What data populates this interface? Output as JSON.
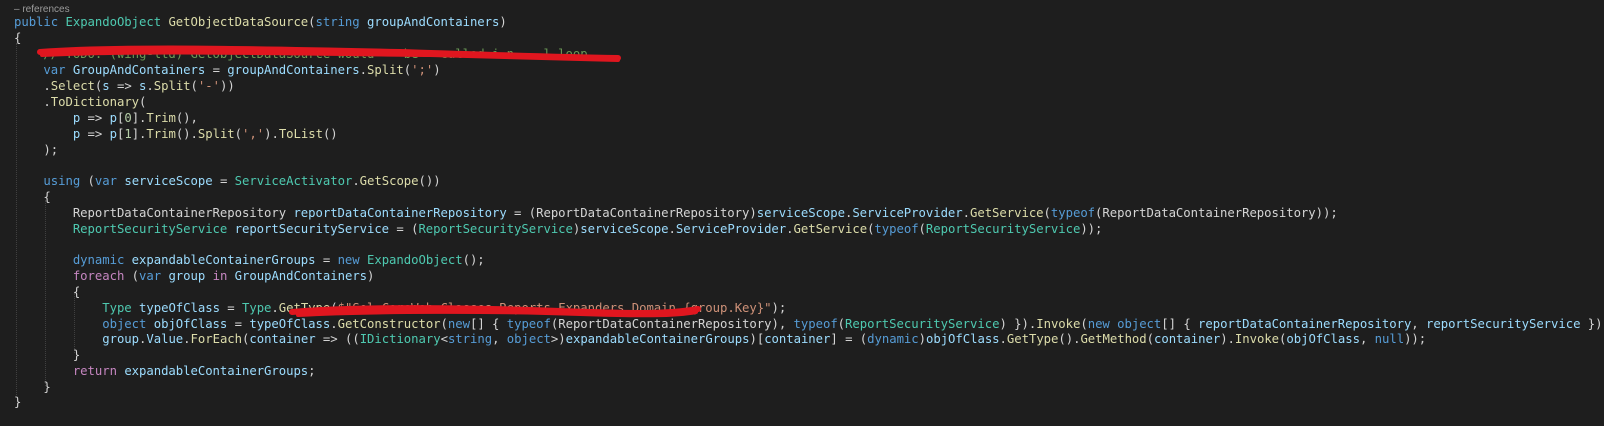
{
  "codelens": "– references",
  "lines": [
    "public ExpandoObject GetObjectDataSource(string groupAndContainers)",
    "{",
    "    // TODO: (wing-ltd) GetObjectDataSource would    be   called i n . .l loop",
    "    var GroupAndContainers = groupAndContainers.Split(';')",
    "    .Select(s => s.Split('-'))",
    "    .ToDictionary(",
    "        p => p[0].Trim(),",
    "        p => p[1].Trim().Split(',').ToList()",
    "    );",
    "",
    "    using (var serviceScope = ServiceActivator.GetScope())",
    "    {",
    "        ReportDataContainerRepository reportDataContainerRepository = (ReportDataContainerRepository)serviceScope.ServiceProvider.GetService(typeof(ReportDataContainerRepository));",
    "        ReportSecurityService reportSecurityService = (ReportSecurityService)serviceScope.ServiceProvider.GetService(typeof(ReportSecurityService));",
    "",
    "        dynamic expandableContainerGroups = new ExpandoObject();",
    "        foreach (var group in GroupAndContainers)",
    "        {",
    "            Type typeOfClass = Type.GetType($\"Sel.CoreWeb.Classes.Reports.Expanders.Domain.{group.Key}\");",
    "            object objOfClass = typeOfClass.GetConstructor(new[] { typeof(ReportDataContainerRepository), typeof(ReportSecurityService) }).Invoke(new object[] { reportDataContainerRepository, reportSecurityService });",
    "            group.Value.ForEach(container => ((IDictionary<string, object>)expandableContainerGroups)[container] = (dynamic)objOfClass.GetType().GetMethod(container).Invoke(objOfClass, null));",
    "        }",
    "        return expandableContainerGroups;",
    "    }",
    "}"
  ],
  "colors": {
    "background": "#1e1e1e",
    "redaction": "#e0161f"
  }
}
